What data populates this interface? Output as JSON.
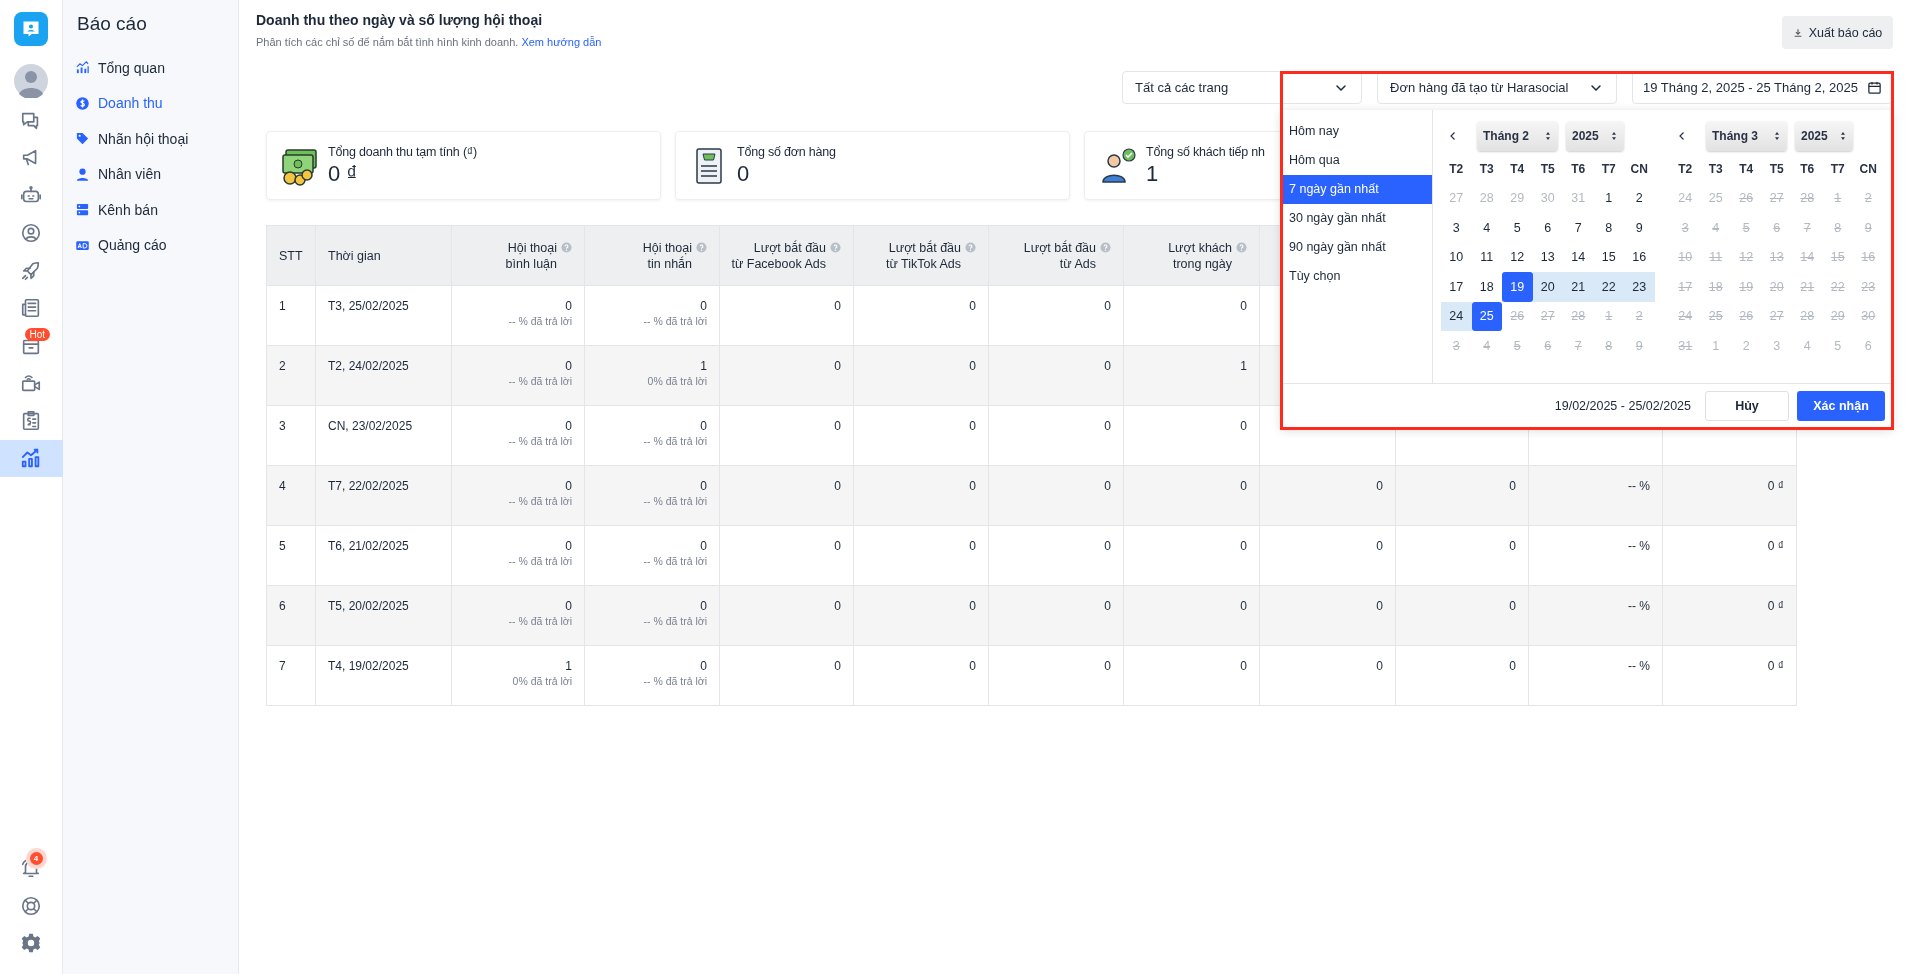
{
  "rail": {
    "items": [
      {
        "selected": false
      },
      {
        "selected": false
      },
      {
        "selected": false
      },
      {
        "selected": false
      },
      {
        "selected": false
      },
      {
        "selected": false
      },
      {
        "selected": false,
        "badge": "Hot"
      },
      {
        "selected": false
      },
      {
        "selected": false
      },
      {
        "selected": true
      }
    ],
    "bottom": [
      {
        "selected": false,
        "badge": "4"
      },
      {
        "selected": false
      },
      {
        "selected": false
      }
    ]
  },
  "nav": {
    "title": "Báo cáo",
    "items": [
      {
        "label": "Tổng quan",
        "selected": false
      },
      {
        "label": "Doanh thu",
        "selected": true
      },
      {
        "label": "Nhãn hội thoại",
        "selected": false
      },
      {
        "label": "Nhân viên",
        "selected": false
      },
      {
        "label": "Kênh bán",
        "selected": false
      },
      {
        "label": "Quảng cáo",
        "selected": false
      }
    ]
  },
  "header": {
    "title": "Doanh thu theo ngày và số lượng hội thoại",
    "subtitle": "Phân tích các chỉ số để nắm bắt tình hình kinh doanh.",
    "help_link": "Xem hướng dẫn",
    "export_button": "Xuất báo cáo"
  },
  "filters": {
    "page_select": "Tất cả các trang",
    "order_select": "Đơn hàng đã tạo từ Harasocial",
    "date_range": "19 Tháng 2, 2025 - 25 Tháng 2, 2025"
  },
  "cards": [
    {
      "label": "Tổng doanh thu tạm tính (₫)",
      "value": "0 ₫"
    },
    {
      "label": "Tổng số đơn hàng",
      "value": "0"
    },
    {
      "label": "Tổng số khách tiếp nh",
      "value": "1"
    }
  ],
  "table": {
    "columns": [
      {
        "label": "STT",
        "help": false
      },
      {
        "label": "Thời gian",
        "help": false
      },
      {
        "label": "Hội thoại\nbình luận",
        "help": true
      },
      {
        "label": "Hội thoại\ntin nhắn",
        "help": true
      },
      {
        "label": "Lượt bắt đầu\ntừ Facebook Ads",
        "help": true
      },
      {
        "label": "Lượt bắt đầu\ntừ TikTok Ads",
        "help": true
      },
      {
        "label": "Lượt bắt đầu\ntừ Ads",
        "help": true
      },
      {
        "label": "Lượt khách\ntrong ngày",
        "help": true
      }
    ],
    "rows": [
      {
        "cells": [
          "1",
          "T3, 25/02/2025",
          {
            "value": "0",
            "note": "-- % đã trả lời"
          },
          {
            "value": "0",
            "note": "-- % đã trả lời"
          },
          "0",
          "0",
          "0",
          "0"
        ]
      },
      {
        "cells": [
          "2",
          "T2, 24/02/2025",
          {
            "value": "0",
            "note": "-- % đã trả lời"
          },
          {
            "value": "1",
            "note": "0% đã trả lời"
          },
          "0",
          "0",
          "0",
          "1"
        ]
      },
      {
        "cells": [
          "3",
          "CN, 23/02/2025",
          {
            "value": "0",
            "note": "-- % đã trả lời"
          },
          {
            "value": "0",
            "note": "-- % đã trả lời"
          },
          "0",
          "0",
          "0",
          "0"
        ]
      },
      {
        "cells": [
          "4",
          "T7, 22/02/2025",
          {
            "value": "0",
            "note": "-- % đã trả lời"
          },
          {
            "value": "0",
            "note": "-- % đã trả lời"
          },
          "0",
          "0",
          "0",
          "0",
          "0",
          "0",
          "-- %",
          "0 ₫"
        ]
      },
      {
        "cells": [
          "5",
          "T6, 21/02/2025",
          {
            "value": "0",
            "note": "-- % đã trả lời"
          },
          {
            "value": "0",
            "note": "-- % đã trả lời"
          },
          "0",
          "0",
          "0",
          "0",
          "0",
          "0",
          "-- %",
          "0 ₫"
        ]
      },
      {
        "cells": [
          "6",
          "T5, 20/02/2025",
          {
            "value": "0",
            "note": "-- % đã trả lời"
          },
          {
            "value": "0",
            "note": "-- % đã trả lời"
          },
          "0",
          "0",
          "0",
          "0",
          "0",
          "0",
          "-- %",
          "0 ₫"
        ]
      },
      {
        "cells": [
          "7",
          "T4, 19/02/2025",
          {
            "value": "1",
            "note": "0% đã trả lời"
          },
          {
            "value": "0",
            "note": "-- % đã trả lời"
          },
          "0",
          "0",
          "0",
          "0",
          "0",
          "0",
          "-- %",
          "0 ₫"
        ]
      }
    ]
  },
  "picker": {
    "presets": [
      {
        "label": "Hôm nay",
        "selected": false
      },
      {
        "label": "Hôm qua",
        "selected": false
      },
      {
        "label": "7 ngày gần nhất",
        "selected": true
      },
      {
        "label": "30 ngày gần nhất",
        "selected": false
      },
      {
        "label": "90 ngày gần nhất",
        "selected": false
      },
      {
        "label": "Tùy chọn",
        "selected": false
      }
    ],
    "months": [
      {
        "month": "Tháng 2",
        "year": "2025",
        "weekdays": [
          "T2",
          "T3",
          "T4",
          "T5",
          "T6",
          "T7",
          "CN"
        ],
        "weeks": [
          [
            {
              "d": "27",
              "kind": "outside"
            },
            {
              "d": "28",
              "kind": "outside"
            },
            {
              "d": "29",
              "kind": "outside"
            },
            {
              "d": "30",
              "kind": "outside"
            },
            {
              "d": "31",
              "kind": "outside"
            },
            {
              "d": "1",
              "kind": "day"
            },
            {
              "d": "2",
              "kind": "day"
            }
          ],
          [
            {
              "d": "3",
              "kind": "day"
            },
            {
              "d": "4",
              "kind": "day"
            },
            {
              "d": "5",
              "kind": "day"
            },
            {
              "d": "6",
              "kind": "day"
            },
            {
              "d": "7",
              "kind": "day"
            },
            {
              "d": "8",
              "kind": "day"
            },
            {
              "d": "9",
              "kind": "day"
            }
          ],
          [
            {
              "d": "10",
              "kind": "day"
            },
            {
              "d": "11",
              "kind": "day"
            },
            {
              "d": "12",
              "kind": "day"
            },
            {
              "d": "13",
              "kind": "day"
            },
            {
              "d": "14",
              "kind": "day"
            },
            {
              "d": "15",
              "kind": "day"
            },
            {
              "d": "16",
              "kind": "day"
            }
          ],
          [
            {
              "d": "17",
              "kind": "day"
            },
            {
              "d": "18",
              "kind": "day"
            },
            {
              "d": "19",
              "kind": "edge"
            },
            {
              "d": "20",
              "kind": "range"
            },
            {
              "d": "21",
              "kind": "range"
            },
            {
              "d": "22",
              "kind": "range"
            },
            {
              "d": "23",
              "kind": "range"
            }
          ],
          [
            {
              "d": "24",
              "kind": "range"
            },
            {
              "d": "25",
              "kind": "edge"
            },
            {
              "d": "26",
              "kind": "off"
            },
            {
              "d": "27",
              "kind": "off"
            },
            {
              "d": "28",
              "kind": "off"
            },
            {
              "d": "1",
              "kind": "off"
            },
            {
              "d": "2",
              "kind": "off"
            }
          ],
          [
            {
              "d": "3",
              "kind": "off"
            },
            {
              "d": "4",
              "kind": "off"
            },
            {
              "d": "5",
              "kind": "off"
            },
            {
              "d": "6",
              "kind": "off"
            },
            {
              "d": "7",
              "kind": "off"
            },
            {
              "d": "8",
              "kind": "off"
            },
            {
              "d": "9",
              "kind": "off"
            }
          ]
        ]
      },
      {
        "month": "Tháng 3",
        "year": "2025",
        "weekdays": [
          "T2",
          "T3",
          "T4",
          "T5",
          "T6",
          "T7",
          "CN"
        ],
        "weeks": [
          [
            {
              "d": "24",
              "kind": "outside"
            },
            {
              "d": "25",
              "kind": "outside"
            },
            {
              "d": "26",
              "kind": "off"
            },
            {
              "d": "27",
              "kind": "off"
            },
            {
              "d": "28",
              "kind": "off"
            },
            {
              "d": "1",
              "kind": "off"
            },
            {
              "d": "2",
              "kind": "off"
            }
          ],
          [
            {
              "d": "3",
              "kind": "off"
            },
            {
              "d": "4",
              "kind": "off"
            },
            {
              "d": "5",
              "kind": "off"
            },
            {
              "d": "6",
              "kind": "off"
            },
            {
              "d": "7",
              "kind": "off"
            },
            {
              "d": "8",
              "kind": "off"
            },
            {
              "d": "9",
              "kind": "off"
            }
          ],
          [
            {
              "d": "10",
              "kind": "off"
            },
            {
              "d": "11",
              "kind": "off"
            },
            {
              "d": "12",
              "kind": "off"
            },
            {
              "d": "13",
              "kind": "off"
            },
            {
              "d": "14",
              "kind": "off"
            },
            {
              "d": "15",
              "kind": "off"
            },
            {
              "d": "16",
              "kind": "off"
            }
          ],
          [
            {
              "d": "17",
              "kind": "off"
            },
            {
              "d": "18",
              "kind": "off"
            },
            {
              "d": "19",
              "kind": "off"
            },
            {
              "d": "20",
              "kind": "off"
            },
            {
              "d": "21",
              "kind": "off"
            },
            {
              "d": "22",
              "kind": "off"
            },
            {
              "d": "23",
              "kind": "off"
            }
          ],
          [
            {
              "d": "24",
              "kind": "off"
            },
            {
              "d": "25",
              "kind": "off"
            },
            {
              "d": "26",
              "kind": "off"
            },
            {
              "d": "27",
              "kind": "off"
            },
            {
              "d": "28",
              "kind": "off"
            },
            {
              "d": "29",
              "kind": "off"
            },
            {
              "d": "30",
              "kind": "off"
            }
          ],
          [
            {
              "d": "31",
              "kind": "off"
            },
            {
              "d": "1",
              "kind": "outside"
            },
            {
              "d": "2",
              "kind": "outside"
            },
            {
              "d": "3",
              "kind": "outside"
            },
            {
              "d": "4",
              "kind": "outside"
            },
            {
              "d": "5",
              "kind": "outside"
            },
            {
              "d": "6",
              "kind": "outside"
            }
          ]
        ]
      }
    ],
    "range_text": "19/02/2025 - 25/02/2025",
    "cancel": "Hủy",
    "confirm": "Xác nhận"
  }
}
